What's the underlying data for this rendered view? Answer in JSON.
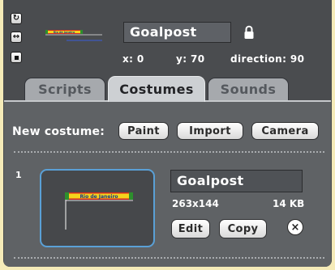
{
  "sprite": {
    "name": "Goalpost",
    "x_label": "x: 0",
    "y_label": "y: 70",
    "direction_label": "direction: 90",
    "thumbnail_banner_text": "Rio de Janeiro"
  },
  "rotation_styles": {
    "can_rotate_icon": "↻",
    "left_right_icon": "↔",
    "dont_rotate_icon": "■"
  },
  "tabs": [
    {
      "label": "Scripts",
      "active": false
    },
    {
      "label": "Costumes",
      "active": true
    },
    {
      "label": "Sounds",
      "active": false
    }
  ],
  "new_costume": {
    "label": "New costume:",
    "buttons": {
      "paint": "Paint",
      "import": "Import",
      "camera": "Camera"
    }
  },
  "costumes": [
    {
      "number": "1",
      "name": "Goalpost",
      "dimensions": "263x144",
      "size": "14 KB",
      "edit_label": "Edit",
      "copy_label": "Copy",
      "delete_icon": "×",
      "banner_text": "Rio de Janeiro"
    }
  ],
  "colors": {
    "tab_active": "#cdd0d3",
    "selection_border": "#5aa0d6",
    "banner_red": "#d62a20",
    "banner_yellow": "#f4d41c",
    "banner_green": "#2d8f2d"
  }
}
